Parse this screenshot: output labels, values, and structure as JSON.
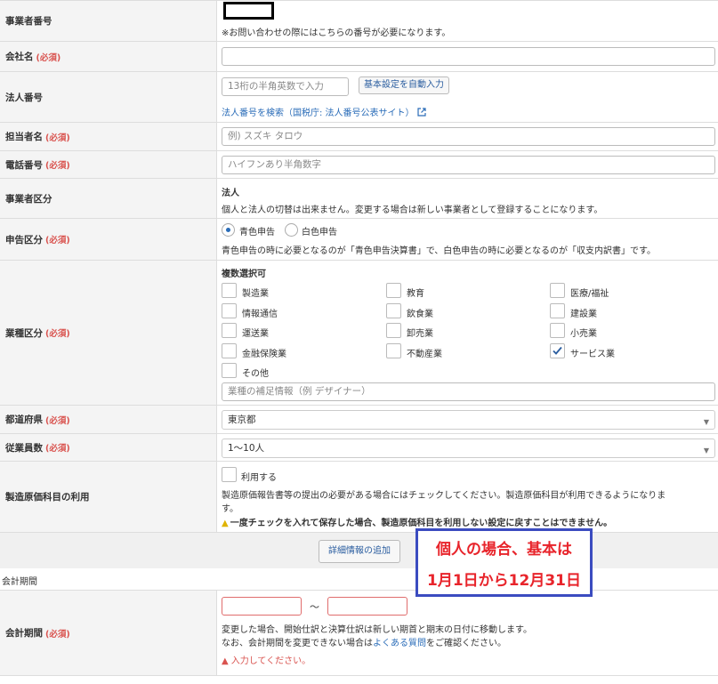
{
  "rows": {
    "business_number": {
      "label": "事業者番号",
      "note": "※お問い合わせの際にはこちらの番号が必要になります。"
    },
    "company_name": {
      "label": "会社名",
      "required": "(必須)",
      "value": ""
    },
    "corporate_number": {
      "label": "法人番号",
      "placeholder": "13桁の半角英数で入力",
      "auto_button": "基本設定を自動入力",
      "search_link": "法人番号を検索（国税庁: 法人番号公表サイト）"
    },
    "contact_name": {
      "label": "担当者名",
      "required": "(必須)",
      "placeholder": "例) スズキ タロウ"
    },
    "phone": {
      "label": "電話番号",
      "required": "(必須)",
      "placeholder": "ハイフンあり半角数字"
    },
    "business_type": {
      "label": "事業者区分",
      "value": "法人",
      "note": "個人と法人の切替は出来ません。変更する場合は新しい事業者として登録することになります。"
    },
    "filing_type": {
      "label": "申告区分",
      "required": "(必須)",
      "option_blue": "青色申告",
      "option_white": "白色申告",
      "selected": "青色申告",
      "note": "青色申告の時に必要となるのが「青色申告決算書」で、白色申告の時に必要となるのが「収支内訳書」です。"
    },
    "industry": {
      "label": "業種区分",
      "required": "(必須)",
      "heading": "複数選択可",
      "options": [
        {
          "label": "製造業",
          "checked": false
        },
        {
          "label": "教育",
          "checked": false
        },
        {
          "label": "医療/福祉",
          "checked": false
        },
        {
          "label": "情報通信",
          "checked": false
        },
        {
          "label": "飲食業",
          "checked": false
        },
        {
          "label": "建設業",
          "checked": false
        },
        {
          "label": "運送業",
          "checked": false
        },
        {
          "label": "卸売業",
          "checked": false
        },
        {
          "label": "小売業",
          "checked": false
        },
        {
          "label": "金融保険業",
          "checked": false
        },
        {
          "label": "不動産業",
          "checked": false
        },
        {
          "label": "サービス業",
          "checked": true
        },
        {
          "label": "その他",
          "checked": false
        }
      ],
      "supplement_placeholder": "業種の補足情報（例 デザイナー）"
    },
    "prefecture": {
      "label": "都道府県",
      "required": "(必須)",
      "value": "東京都"
    },
    "employees": {
      "label": "従業員数",
      "required": "(必須)",
      "value": "1〜10人"
    },
    "manufacturing_cost": {
      "label": "製造原価科目の利用",
      "checkbox_label": "利用する",
      "note_line1": "製造原価報告書等の提出の必要がある場合にはチェックしてください。製造原価科目が利用できるようになりま",
      "note_line2": "す。",
      "warning": "一度チェックを入れて保存した場合、製造原価科目を利用しない設定に戻すことはできません。"
    }
  },
  "add_details_button": "詳細情報の追加",
  "accounting_section_title": "会計期間",
  "accounting_period": {
    "label": "会計期間",
    "required": "(必須)",
    "separator": "〜",
    "note_line1": "変更した場合、開始仕訳と決算仕訳は新しい期首と期末の日付に移動します。",
    "note_line2_pre": "なお、会計期間を変更できない場合は",
    "note_line2_link": "よくある質問",
    "note_line2_post": "をご確認ください。",
    "error": "入力してください。"
  },
  "annotation": {
    "line1": "個人の場合、基本は",
    "line2": "1月1日から12月31日"
  },
  "colors": {
    "required": "#d9534f",
    "link": "#2a6cb8",
    "annotation_text": "#e8242b",
    "annotation_border": "#3b4cc0"
  }
}
